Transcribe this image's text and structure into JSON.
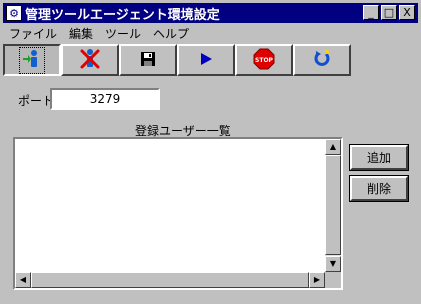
{
  "window": {
    "title": "管理ツールエージェント環境設定",
    "minimize": "_",
    "maximize": "□",
    "close": "X"
  },
  "menu": [
    "ファイル",
    "編集",
    "ツール",
    "ヘルプ"
  ],
  "toolbar": {
    "buttons": [
      "add-user",
      "delete-user",
      "save",
      "start",
      "stop",
      "refresh"
    ]
  },
  "port": {
    "label": "ポート:",
    "value": "3279"
  },
  "user_list": {
    "title": "登録ユーザー一覧",
    "items": []
  },
  "actions": {
    "add": "追加",
    "delete": "削除"
  },
  "colors": {
    "titlebar": "#000080",
    "face": "#c0c0c0"
  }
}
